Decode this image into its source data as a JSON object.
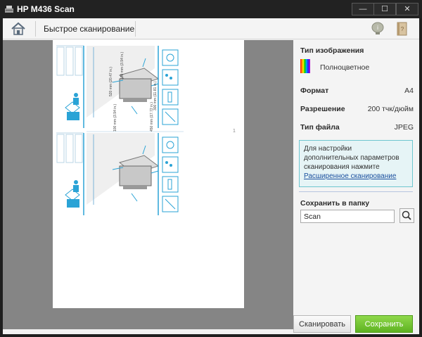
{
  "window": {
    "title": "HP M436 Scan",
    "min_glyph": "—",
    "max_glyph": "☐",
    "close_glyph": "✕"
  },
  "toolbar": {
    "title": "Быстрое сканирование",
    "home_icon": "home-icon",
    "help_icon": "lightbulb-icon",
    "manual_icon": "book-icon"
  },
  "preview": {
    "page_number": "1",
    "diagram": {
      "top_dim": "520 mm (20.47 in.)",
      "side_dim": "100 mm (3.94 in.)",
      "right_dim": "300 mm (11.81 in.)",
      "bottom_dim": "450 mm (17.72 in.)",
      "small_dim": "100 mm (3.94 in.)"
    }
  },
  "settings": {
    "image_type_label": "Тип изображения",
    "image_type_value": "Полноцветное",
    "format_label": "Формат",
    "format_value": "A4",
    "resolution_label": "Разрешение",
    "resolution_value": "200 тчк/дюйм",
    "file_type_label": "Тип файла",
    "file_type_value": "JPEG",
    "info_text": "Для настройки дополнительных параметров сканирования нажмите ",
    "info_link": "Расширенное сканирование",
    "save_folder_label": "Сохранить в папку",
    "save_folder_value": "Scan"
  },
  "footer": {
    "scan_label": "Сканировать",
    "save_label": "Сохранить"
  },
  "colors": {
    "save_green": "#6cbf2e",
    "info_border": "#6ec6cf",
    "link_blue": "#1a4f9e"
  }
}
